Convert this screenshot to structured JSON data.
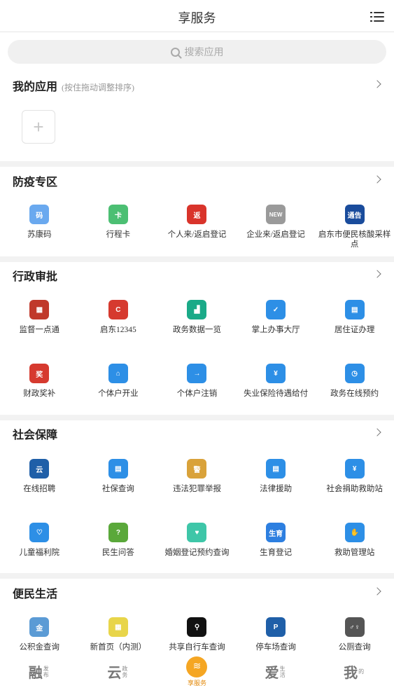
{
  "header": {
    "title": "享服务"
  },
  "search": {
    "placeholder": "搜索应用"
  },
  "my_apps": {
    "title": "我的应用",
    "hint": "(按住拖动调整排序)",
    "add_symbol": "+"
  },
  "sections": [
    {
      "title": "防疫专区",
      "rows": [
        [
          {
            "label": "苏康码",
            "icon": "health-code-icon",
            "color": "#6aa9ef",
            "glyph": "码"
          },
          {
            "label": "行程卡",
            "icon": "trip-card-icon",
            "color": "#4cbf73",
            "glyph": "卡"
          },
          {
            "label": "个人来/返启登记",
            "icon": "return-register-icon",
            "color": "#d9342b",
            "glyph": "返"
          },
          {
            "label": "企业来/返启登记",
            "icon": "enterprise-register-icon",
            "color": "#9a9a9a",
            "glyph": "NEW"
          },
          {
            "label": "启东市便民核酸采样点",
            "icon": "notice-icon",
            "color": "#1a4c9c",
            "glyph": "通告"
          }
        ]
      ]
    },
    {
      "title": "行政审批",
      "rows": [
        [
          {
            "label": "监督一点通",
            "icon": "qr-supervision-icon",
            "color": "#c0392b",
            "glyph": "▦"
          },
          {
            "label": "启东12345",
            "icon": "hotline-icon",
            "color": "#d63a2f",
            "glyph": "C"
          },
          {
            "label": "政务数据一览",
            "icon": "data-chart-icon",
            "color": "#1aaa88",
            "glyph": "▟"
          },
          {
            "label": "掌上办事大厅",
            "icon": "monitor-check-icon",
            "color": "#2d8fe6",
            "glyph": "✓"
          },
          {
            "label": "居住证办理",
            "icon": "id-card-icon",
            "color": "#2d8fe6",
            "glyph": "▤"
          }
        ],
        [
          {
            "label": "财政奖补",
            "icon": "finance-award-icon",
            "color": "#d63a2f",
            "glyph": "奖"
          },
          {
            "label": "个体户开业",
            "icon": "shop-open-icon",
            "color": "#2d8fe6",
            "glyph": "⌂"
          },
          {
            "label": "个体户注销",
            "icon": "logout-icon",
            "color": "#2d8fe6",
            "glyph": "→"
          },
          {
            "label": "失业保险待遇给付",
            "icon": "insurance-icon",
            "color": "#2d8fe6",
            "glyph": "¥"
          },
          {
            "label": "政务在线预约",
            "icon": "calendar-icon",
            "color": "#2d8fe6",
            "glyph": "◷"
          }
        ]
      ]
    },
    {
      "title": "社会保障",
      "rows": [
        [
          {
            "label": "在线招聘",
            "icon": "recruit-icon",
            "color": "#1f5fa8",
            "glyph": "云"
          },
          {
            "label": "社保查询",
            "icon": "social-security-icon",
            "color": "#2d8fe6",
            "glyph": "▤"
          },
          {
            "label": "违法犯罪举报",
            "icon": "police-report-icon",
            "color": "#d9a23a",
            "glyph": "警"
          },
          {
            "label": "法律援助",
            "icon": "legal-aid-icon",
            "color": "#2d8fe6",
            "glyph": "▤"
          },
          {
            "label": "社会捐助救助站",
            "icon": "donation-icon",
            "color": "#2d8fe6",
            "glyph": "¥"
          }
        ],
        [
          {
            "label": "儿童福利院",
            "icon": "child-welfare-icon",
            "color": "#2d8fe6",
            "glyph": "♡"
          },
          {
            "label": "民生问答",
            "icon": "qa-icon",
            "color": "#5aa83a",
            "glyph": "?"
          },
          {
            "label": "婚姻登记预约查询",
            "icon": "marriage-icon",
            "color": "#3ec6a8",
            "glyph": "♥"
          },
          {
            "label": "生育登记",
            "icon": "birth-register-icon",
            "color": "#2d7fe0",
            "glyph": "生育"
          },
          {
            "label": "救助管理站",
            "icon": "handshake-icon",
            "color": "#2d8fe6",
            "glyph": "✋"
          }
        ]
      ]
    },
    {
      "title": "便民生活",
      "rows": [
        [
          {
            "label": "公积金查询",
            "icon": "housing-fund-icon",
            "color": "#5b9bd5",
            "glyph": "金"
          },
          {
            "label": "新首页（内测）",
            "icon": "new-home-icon",
            "color": "#e8d54a",
            "glyph": "▦"
          },
          {
            "label": "共享自行车查询",
            "icon": "bike-icon",
            "color": "#111111",
            "glyph": "⚲"
          },
          {
            "label": "停车场查询",
            "icon": "parking-icon",
            "color": "#1f5fa8",
            "glyph": "P"
          },
          {
            "label": "公厕查询",
            "icon": "toilet-icon",
            "color": "#555555",
            "glyph": "♂♀"
          }
        ]
      ]
    }
  ],
  "tabbar": [
    {
      "big": "融",
      "small": "发布",
      "name": "tab-rong"
    },
    {
      "big": "云",
      "small": "政务",
      "name": "tab-yun"
    },
    {
      "label": "享服务",
      "name": "tab-xiang",
      "active": true
    },
    {
      "big": "爱",
      "small": "生活",
      "name": "tab-ai"
    },
    {
      "big": "我",
      "small": "的",
      "name": "tab-wo"
    }
  ]
}
